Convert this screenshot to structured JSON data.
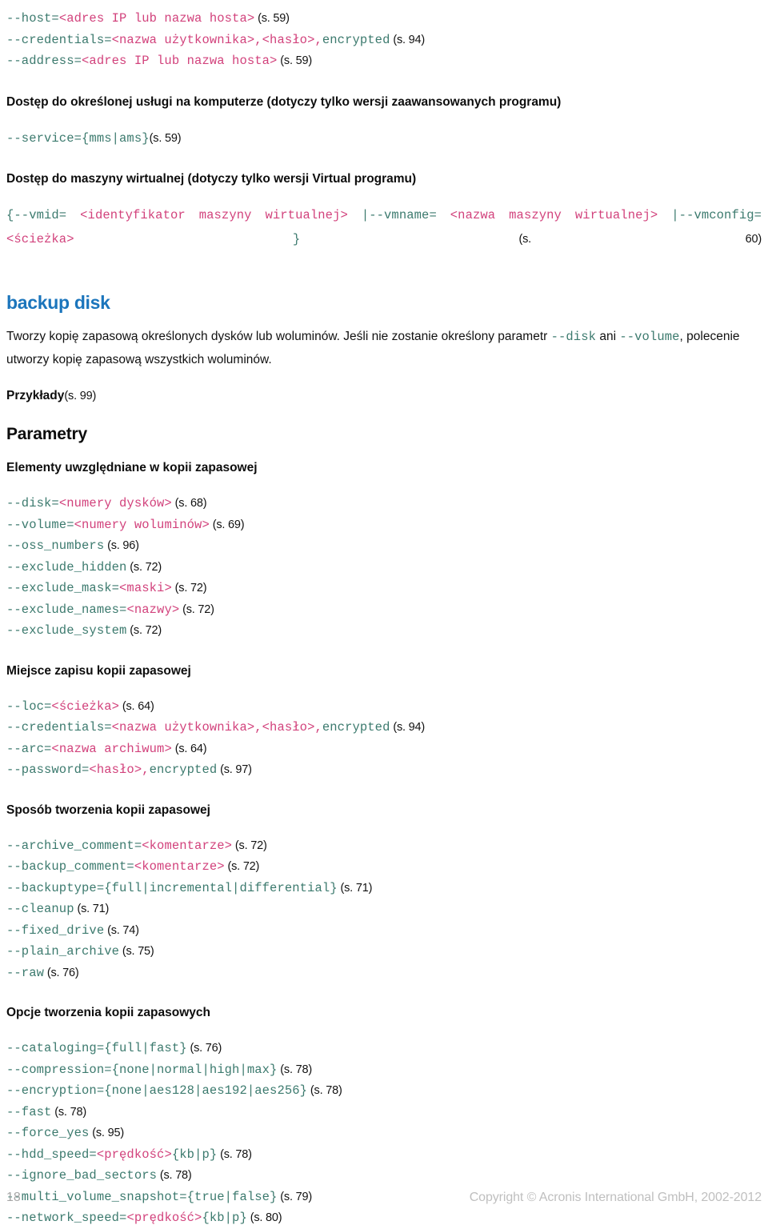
{
  "document": {
    "language": "pl",
    "colors": {
      "flag": "#3c7a6e",
      "placeholder": "#d2427c",
      "command_heading": "#1b75bc",
      "footer_text": "#bfbfbf",
      "body_text": "#111111"
    }
  },
  "top_params": [
    {
      "flag": "--host=",
      "placeholder": "<adres IP lub nazwa hosta>",
      "tail": "",
      "ref": "(s. 59)"
    },
    {
      "flag": "--credentials=",
      "placeholder": "<nazwa użytkownika>,<hasło>,",
      "tail": "encrypted",
      "ref": "(s. 94)"
    },
    {
      "flag": "--address=",
      "placeholder": "<adres IP lub nazwa hosta>",
      "tail": "",
      "ref": "(s. 59)"
    }
  ],
  "service_section": {
    "heading": "Dostęp do określonej usługi na komputerze (dotyczy tylko wersji zaawansowanych programu)",
    "param": {
      "flag": "--service=",
      "value": "{mms|ams}",
      "ref": "(s. 59)"
    }
  },
  "vm_section": {
    "heading": "Dostęp do maszyny wirtualnej (dotyczy tylko wersji Virtual programu)",
    "tokens": [
      {
        "text": "{--vmid=",
        "kind": "flag"
      },
      {
        "text": "<identyfikator",
        "kind": "ph"
      },
      {
        "text": "maszyny",
        "kind": "ph"
      },
      {
        "text": "wirtualnej>",
        "kind": "ph"
      },
      {
        "text": "|--vmname=",
        "kind": "flag"
      },
      {
        "text": "<nazwa",
        "kind": "ph"
      },
      {
        "text": "maszyny",
        "kind": "ph"
      },
      {
        "text": "wirtualnej>",
        "kind": "ph"
      },
      {
        "text": "|--vmconfig=",
        "kind": "flag"
      },
      {
        "text": "<ścieżka>",
        "kind": "ph"
      },
      {
        "text": "}",
        "kind": "flag"
      }
    ],
    "ref": "(s. 60)"
  },
  "command": {
    "title": "backup disk",
    "description_pre": "Tworzy kopię zapasową określonych dysków lub woluminów. Jeśli nie zostanie określony parametr ",
    "description_code1": "--disk",
    "description_mid": " ani ",
    "description_code2": "--volume",
    "description_post": ", polecenie utworzy kopię zapasową wszystkich woluminów.",
    "examples_label": "Przykłady",
    "examples_ref": "(s. 99)",
    "parameters_title": "Parametry"
  },
  "groups": [
    {
      "title": "Elementy uwzględniane w kopii zapasowej",
      "params": [
        {
          "flag": "--disk=",
          "placeholder": "<numery dysków>",
          "tail": "",
          "ref": "(s. 68)"
        },
        {
          "flag": "--volume=",
          "placeholder": "<numery woluminów>",
          "tail": "",
          "ref": "(s. 69)"
        },
        {
          "flag": "--oss_numbers",
          "placeholder": "",
          "tail": "",
          "ref": "(s. 96)"
        },
        {
          "flag": "--exclude_hidden",
          "placeholder": "",
          "tail": "",
          "ref": "(s. 72)"
        },
        {
          "flag": "--exclude_mask=",
          "placeholder": "<maski>",
          "tail": "",
          "ref": "(s. 72)"
        },
        {
          "flag": "--exclude_names=",
          "placeholder": "<nazwy>",
          "tail": "",
          "ref": "(s. 72)"
        },
        {
          "flag": "--exclude_system",
          "placeholder": "",
          "tail": "",
          "ref": "(s. 72)"
        }
      ]
    },
    {
      "title": "Miejsce zapisu kopii zapasowej",
      "params": [
        {
          "flag": "--loc=",
          "placeholder": "<ścieżka>",
          "tail": "",
          "ref": "(s. 64)"
        },
        {
          "flag": "--credentials=",
          "placeholder": "<nazwa użytkownika>,<hasło>,",
          "tail": "encrypted",
          "ref": "(s. 94)"
        },
        {
          "flag": "--arc=",
          "placeholder": "<nazwa archiwum>",
          "tail": "",
          "ref": "(s. 64)"
        },
        {
          "flag": "--password=",
          "placeholder": "<hasło>,",
          "tail": "encrypted",
          "ref": "(s. 97)"
        }
      ]
    },
    {
      "title": "Sposób tworzenia kopii zapasowej",
      "params": [
        {
          "flag": "--archive_comment=",
          "placeholder": "<komentarze>",
          "tail": "",
          "ref": "(s. 72)"
        },
        {
          "flag": "--backup_comment=",
          "placeholder": "<komentarze>",
          "tail": "",
          "ref": "(s. 72)"
        },
        {
          "flag": "--backuptype={full|incremental|differential}",
          "placeholder": "",
          "tail": "",
          "ref": "(s. 71)"
        },
        {
          "flag": "--cleanup",
          "placeholder": "",
          "tail": "",
          "ref": "(s. 71)"
        },
        {
          "flag": "--fixed_drive",
          "placeholder": "",
          "tail": "",
          "ref": "(s. 74)"
        },
        {
          "flag": "--plain_archive",
          "placeholder": "",
          "tail": "",
          "ref": "(s. 75)"
        },
        {
          "flag": "--raw",
          "placeholder": "",
          "tail": "",
          "ref": "(s. 76)"
        }
      ]
    },
    {
      "title": "Opcje tworzenia kopii zapasowych",
      "params": [
        {
          "flag": "--cataloging={full|fast}",
          "placeholder": "",
          "tail": "",
          "ref": "(s. 76)"
        },
        {
          "flag": "--compression={none|normal|high|max}",
          "placeholder": "",
          "tail": "",
          "ref": "(s. 78)"
        },
        {
          "flag": "--encryption={none|aes128|aes192|aes256}",
          "placeholder": "",
          "tail": "",
          "ref": "(s. 78)"
        },
        {
          "flag": "--fast",
          "placeholder": "",
          "tail": "",
          "ref": "(s. 78)"
        },
        {
          "flag": "--force_yes",
          "placeholder": "",
          "tail": "",
          "ref": "(s. 95)"
        },
        {
          "flag": "--hdd_speed=",
          "placeholder": "<prędkość>",
          "tail": "{kb|p}",
          "ref": "(s. 78)"
        },
        {
          "flag": "--ignore_bad_sectors",
          "placeholder": "",
          "tail": "",
          "ref": "(s. 78)"
        },
        {
          "flag": "--multi_volume_snapshot={true|false}",
          "placeholder": "",
          "tail": "",
          "ref": "(s. 79)"
        },
        {
          "flag": "--network_speed=",
          "placeholder": "<prędkość>",
          "tail": "{kb|p}",
          "ref": "(s. 80)"
        }
      ]
    }
  ],
  "footer": {
    "page_number": "18",
    "copyright": "Copyright © Acronis International GmbH, 2002-2012"
  }
}
